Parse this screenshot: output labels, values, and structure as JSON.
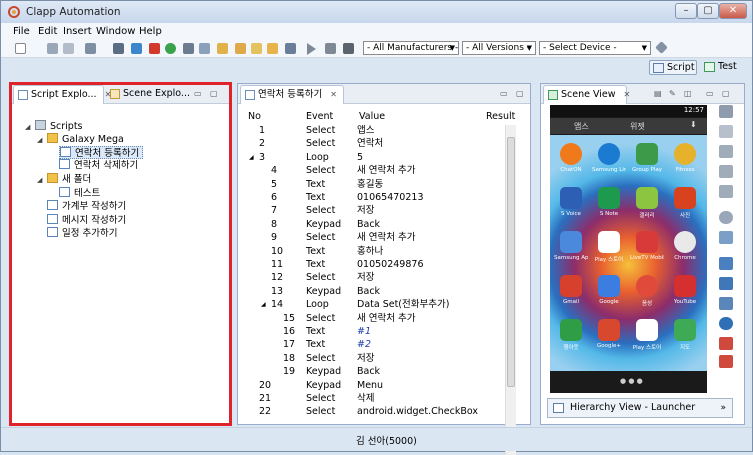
{
  "window": {
    "title": "Clapp Automation"
  },
  "menu": [
    "File",
    "Edit",
    "Insert",
    "Window",
    "Help"
  ],
  "toolbar": {
    "manufacturers": "- All Manufacturers -",
    "versions": "- All Versions -",
    "device": "- Select Device -"
  },
  "perspectives": {
    "script": "Script",
    "test": "Test"
  },
  "script_explorer": {
    "tab_label": "Script Explo...",
    "other_tab_label": "Scene Explo...",
    "tree": {
      "root": "Scripts",
      "galaxy": "Galaxy Mega",
      "item1": "연락처 등록하기",
      "item2": "연락처 삭제하기",
      "folder2": "새 폴더",
      "test": "테스트",
      "item3": "가계부 작성하기",
      "item4": "메시지 작성하기",
      "item5": "일정 추가하기"
    }
  },
  "editor": {
    "tab_label": "연락처 등록하기",
    "columns": {
      "no": "No",
      "event": "Event",
      "value": "Value",
      "result": "Result"
    },
    "rows": [
      {
        "no": "1",
        "event": "Select",
        "value": "앱스"
      },
      {
        "no": "2",
        "event": "Select",
        "value": "연락처"
      },
      {
        "no": "3",
        "event": "Loop",
        "value": "5"
      },
      {
        "no": "4",
        "event": "Select",
        "value": "새 연락처 추가"
      },
      {
        "no": "5",
        "event": "Text",
        "value": "홍길동"
      },
      {
        "no": "6",
        "event": "Text",
        "value": "01065470213"
      },
      {
        "no": "7",
        "event": "Select",
        "value": "저장"
      },
      {
        "no": "8",
        "event": "Keypad",
        "value": "Back"
      },
      {
        "no": "9",
        "event": "Select",
        "value": "새 연락처 추가"
      },
      {
        "no": "10",
        "event": "Text",
        "value": "홍하나"
      },
      {
        "no": "11",
        "event": "Text",
        "value": "01050249876"
      },
      {
        "no": "12",
        "event": "Select",
        "value": "저장"
      },
      {
        "no": "13",
        "event": "Keypad",
        "value": "Back"
      },
      {
        "no": "14",
        "event": "Loop",
        "value": "Data Set(전화부추가)"
      },
      {
        "no": "15",
        "event": "Select",
        "value": "새 연락처 추가"
      },
      {
        "no": "16",
        "event": "Text",
        "value": "#1"
      },
      {
        "no": "17",
        "event": "Text",
        "value": "#2"
      },
      {
        "no": "18",
        "event": "Select",
        "value": "저장"
      },
      {
        "no": "19",
        "event": "Keypad",
        "value": "Back"
      },
      {
        "no": "20",
        "event": "Keypad",
        "value": "Menu"
      },
      {
        "no": "21",
        "event": "Select",
        "value": "삭제"
      },
      {
        "no": "22",
        "event": "Select",
        "value": "android.widget.CheckBox"
      }
    ]
  },
  "scene_view": {
    "tab_label": "Scene View",
    "phone": {
      "time": "12:57",
      "tabs": [
        "앱스",
        "위젯"
      ],
      "apps": [
        "ChatON",
        "Samsung Link",
        "Group Play",
        "Fitness",
        "S Voice",
        "S Note",
        "갤러리",
        "사진",
        "Samsung Apps",
        "Play 스토어",
        "LiveTV Mobile",
        "Chrome",
        "Gmail",
        "Google",
        "음성",
        "YouTube",
        "행아웃",
        "Google+",
        "Play 스토어",
        "지도"
      ]
    },
    "hierarchy": "Hierarchy View - Launcher"
  },
  "status": {
    "text": "김 선아(5000)"
  }
}
